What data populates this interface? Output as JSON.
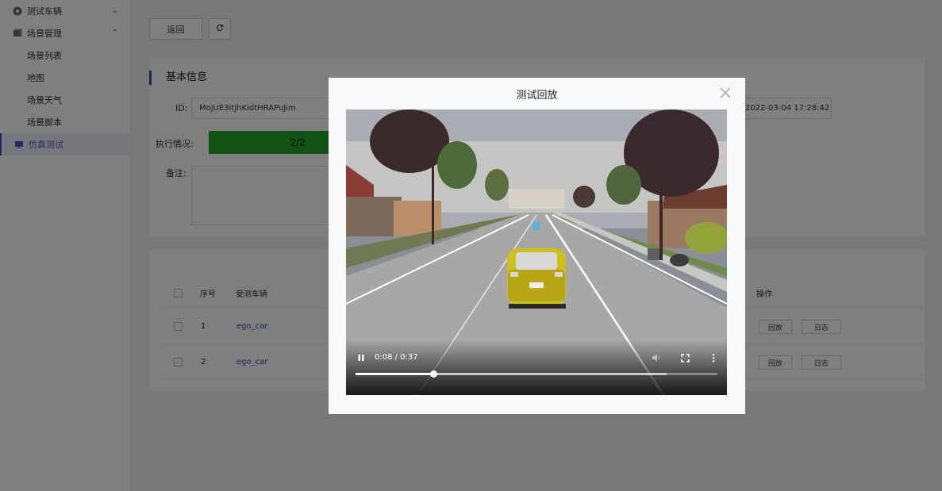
{
  "sidebar": {
    "items": [
      {
        "label": "测试车辆",
        "icon": "gauge-icon",
        "expanded": false
      },
      {
        "label": "场景管理",
        "icon": "layers-icon",
        "expanded": true
      }
    ],
    "sub_items": [
      "场景列表",
      "地图",
      "场景天气",
      "场景脚本"
    ],
    "active_item": {
      "label": "仿真测试",
      "icon": "monitor-icon"
    }
  },
  "toolbar": {
    "back_label": "返回",
    "refresh_icon": "refresh-icon"
  },
  "basic_info": {
    "title": "基本信息",
    "id_label": "ID:",
    "id_value": "MojUE3itJhKidtHRAPuJim",
    "time_value": "2022-03-04 17:28:42",
    "exec_label": "执行情况:",
    "exec_value": "2/2",
    "exec_progress": 1.0,
    "note_label": "备注:"
  },
  "table": {
    "headers": {
      "index": "序号",
      "vehicle": "受测车辆",
      "actions": "操作"
    },
    "rows": [
      {
        "index": "1",
        "vehicle": "ego_car",
        "replay": "回放",
        "log": "日志"
      },
      {
        "index": "2",
        "vehicle": "ego_car",
        "replay": "回放",
        "log": "日志"
      }
    ]
  },
  "modal": {
    "title": "测试回放",
    "close_icon": "close-icon",
    "video": {
      "time": "0:08 / 0:37",
      "progress": 0.216,
      "buffered": 0.86,
      "playing": true,
      "icons": [
        "pause-icon",
        "volume-icon",
        "fullscreen-icon",
        "more-vertical-icon"
      ]
    }
  },
  "colors": {
    "accent": "#3c4ab8",
    "progress": "#23a72a",
    "link": "#3d46b8"
  }
}
